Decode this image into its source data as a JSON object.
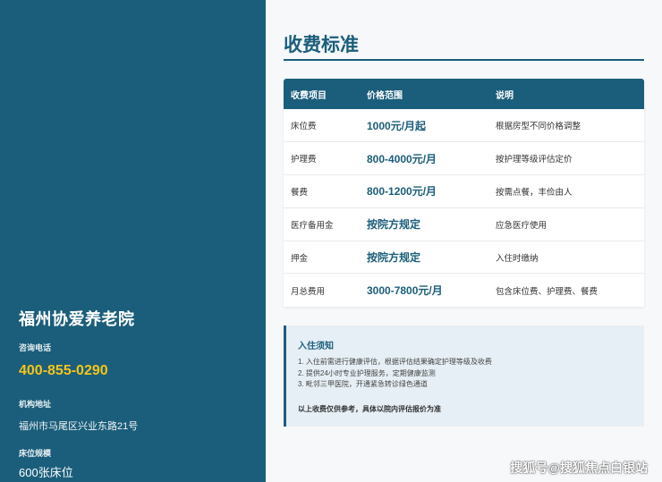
{
  "sidebar": {
    "org_name": "福州协爱养老院",
    "phone_label": "咨询电话",
    "phone": "400-855-0290",
    "address_label": "机构地址",
    "address": "福州市马尾区兴业东路21号",
    "beds_label": "床位规模",
    "beds": "600张床位"
  },
  "main": {
    "title": "收费标准",
    "table": {
      "headers": [
        "收费项目",
        "价格范围",
        "说明"
      ],
      "rows": [
        [
          "床位费",
          "1000元/月起",
          "根据房型不同价格调整"
        ],
        [
          "护理费",
          "800-4000元/月",
          "按护理等级评估定价"
        ],
        [
          "餐费",
          "800-1200元/月",
          "按需点餐，丰俭由人"
        ],
        [
          "医疗备用金",
          "按院方规定",
          "应急医疗使用"
        ],
        [
          "押金",
          "按院方规定",
          "入住时缴纳"
        ],
        [
          "月总费用",
          "3000-7800元/月",
          "包含床位费、护理费、餐费"
        ]
      ]
    },
    "notice": {
      "title": "入住须知",
      "items": [
        "1. 入住前需进行健康评估，根据评估结果确定护理等级及收费",
        "2. 提供24小时专业护理服务，定期健康监测",
        "3. 毗邻三甲医院，开通紧急转诊绿色通道"
      ],
      "footer": "以上收费仅供参考，具体以院内评估报价为准"
    }
  },
  "watermark": "搜狐号@搜狐焦点白银站",
  "colors": {
    "primary": "#1b5e7b",
    "accent": "#f5c518",
    "notice_bg": "#e6eff5"
  }
}
